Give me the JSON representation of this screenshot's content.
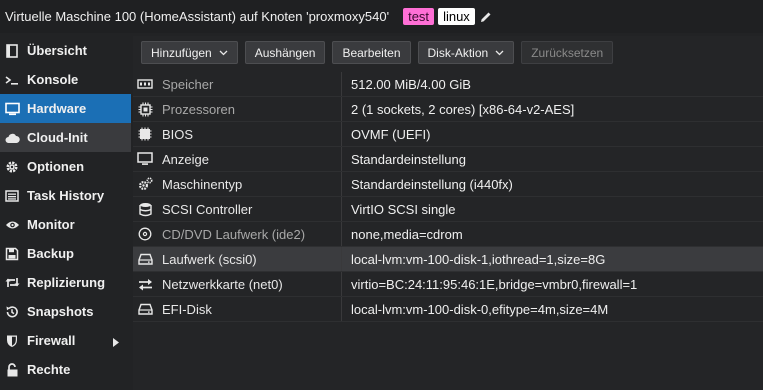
{
  "header": {
    "title": "Virtuelle Maschine 100 (HomeAssistant) auf Knoten 'proxmoxy540'",
    "tags": [
      "test",
      "linux"
    ]
  },
  "sidebar": {
    "items": [
      {
        "label": "Übersicht",
        "icon": "book-icon"
      },
      {
        "label": "Konsole",
        "icon": "terminal-icon"
      },
      {
        "label": "Hardware",
        "icon": "monitor-icon"
      },
      {
        "label": "Cloud-Init",
        "icon": "cloud-icon"
      },
      {
        "label": "Optionen",
        "icon": "gear-icon"
      },
      {
        "label": "Task History",
        "icon": "list-icon"
      },
      {
        "label": "Monitor",
        "icon": "eye-icon"
      },
      {
        "label": "Backup",
        "icon": "floppy-icon"
      },
      {
        "label": "Replizierung",
        "icon": "retweet-icon"
      },
      {
        "label": "Snapshots",
        "icon": "history-icon"
      },
      {
        "label": "Firewall",
        "icon": "shield-icon"
      },
      {
        "label": "Rechte",
        "icon": "unlock-icon"
      }
    ]
  },
  "toolbar": {
    "add": "Hinzufügen",
    "detach": "Aushängen",
    "edit": "Bearbeiten",
    "disk_action": "Disk-Aktion",
    "reset": "Zurücksetzen"
  },
  "hardware": [
    {
      "name": "Speicher",
      "value": "512.00 MiB/4.00 GiB",
      "icon": "memory-icon",
      "muted": true
    },
    {
      "name": "Prozessoren",
      "value": "2 (1 sockets, 2 cores) [x86-64-v2-AES]",
      "icon": "cpu-icon",
      "muted": true
    },
    {
      "name": "BIOS",
      "value": "OVMF (UEFI)",
      "icon": "chip-icon",
      "muted": false
    },
    {
      "name": "Anzeige",
      "value": "Standardeinstellung",
      "icon": "desktop-icon",
      "muted": false
    },
    {
      "name": "Maschinentyp",
      "value": "Standardeinstellung (i440fx)",
      "icon": "cogs-icon",
      "muted": false
    },
    {
      "name": "SCSI Controller",
      "value": "VirtIO SCSI single",
      "icon": "database-icon",
      "muted": false
    },
    {
      "name": "CD/DVD Laufwerk (ide2)",
      "value": "none,media=cdrom",
      "icon": "cdrom-icon",
      "muted": true
    },
    {
      "name": "Laufwerk (scsi0)",
      "value": "local-lvm:vm-100-disk-1,iothread=1,size=8G",
      "icon": "hdd-icon",
      "muted": false
    },
    {
      "name": "Netzwerkkarte (net0)",
      "value": "virtio=BC:24:11:95:46:1E,bridge=vmbr0,firewall=1",
      "icon": "exchange-icon",
      "muted": false
    },
    {
      "name": "EFI-Disk",
      "value": "local-lvm:vm-100-disk-0,efitype=4m,size=4M",
      "icon": "hdd-icon",
      "muted": false
    }
  ],
  "colors": {
    "active_nav": "#1b6fb5",
    "tag_test": "#ff6fd6",
    "tag_linux": "#ffffff"
  }
}
